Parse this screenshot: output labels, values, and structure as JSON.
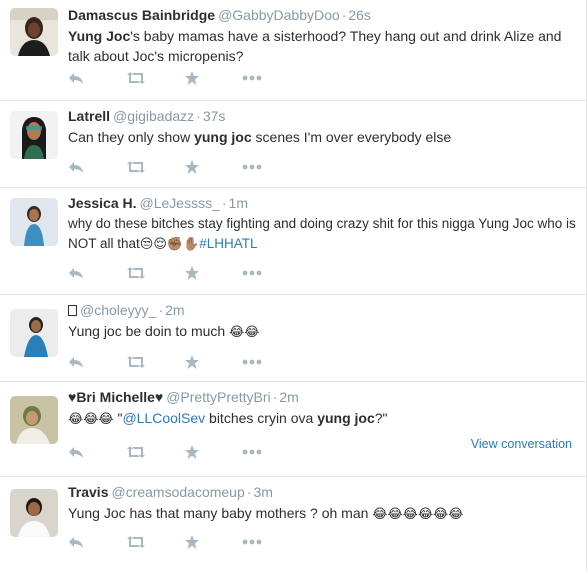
{
  "tweets": [
    {
      "fullname": "Damascus Bainbridge",
      "username": "@GabbyDabbyDoo",
      "time": "26s",
      "text_bold": "Yung Joc",
      "text_rest": "'s baby mamas have a sisterhood? They hang out and drink Alize and talk about Joc's micropenis?"
    },
    {
      "fullname": "Latrell",
      "username": "@gigibadazz",
      "time": "37s",
      "text_pre": "Can they only show ",
      "text_bold": "yung joc",
      "text_post": " scenes I'm over everybody else"
    },
    {
      "fullname": "Jessica H.",
      "username": "@LeJessss_",
      "time": "1m",
      "text": "why do these bitches stay fighting and doing crazy shit for this nigga Yung Joc who is NOT all that",
      "emojis": "😒😌✊🏽✋🏽",
      "hashtag": "#LHHATL"
    },
    {
      "fullname": "",
      "username": "@choleyyy_",
      "time": "2m",
      "text": "Yung joc be doin to much ",
      "emojis": "😂😂"
    },
    {
      "fullname": "♥Bri Michelle♥",
      "username": "@PrettyPrettyBri",
      "time": "2m",
      "emojis": "😂😂😂",
      "quote_open": " \"",
      "mention": "@LLCoolSev",
      "text_mid": " bitches cryin ova ",
      "text_bold": "yung joc",
      "quote_close": "?\"",
      "view_conversation": "View conversation"
    },
    {
      "fullname": "Travis",
      "username": "@creamsodacomeup",
      "time": "3m",
      "text": "Yung Joc has that many baby mothers ? oh man ",
      "emojis": "😂😂😂😂😂😂"
    }
  ],
  "separator": "·",
  "icons": [
    "reply-icon",
    "retweet-icon",
    "favorite-icon",
    "more-icon"
  ],
  "colors": {
    "link": "#2b7bb9",
    "muted": "#8899a6",
    "icon": "#aab8c2",
    "text": "#292f33"
  }
}
